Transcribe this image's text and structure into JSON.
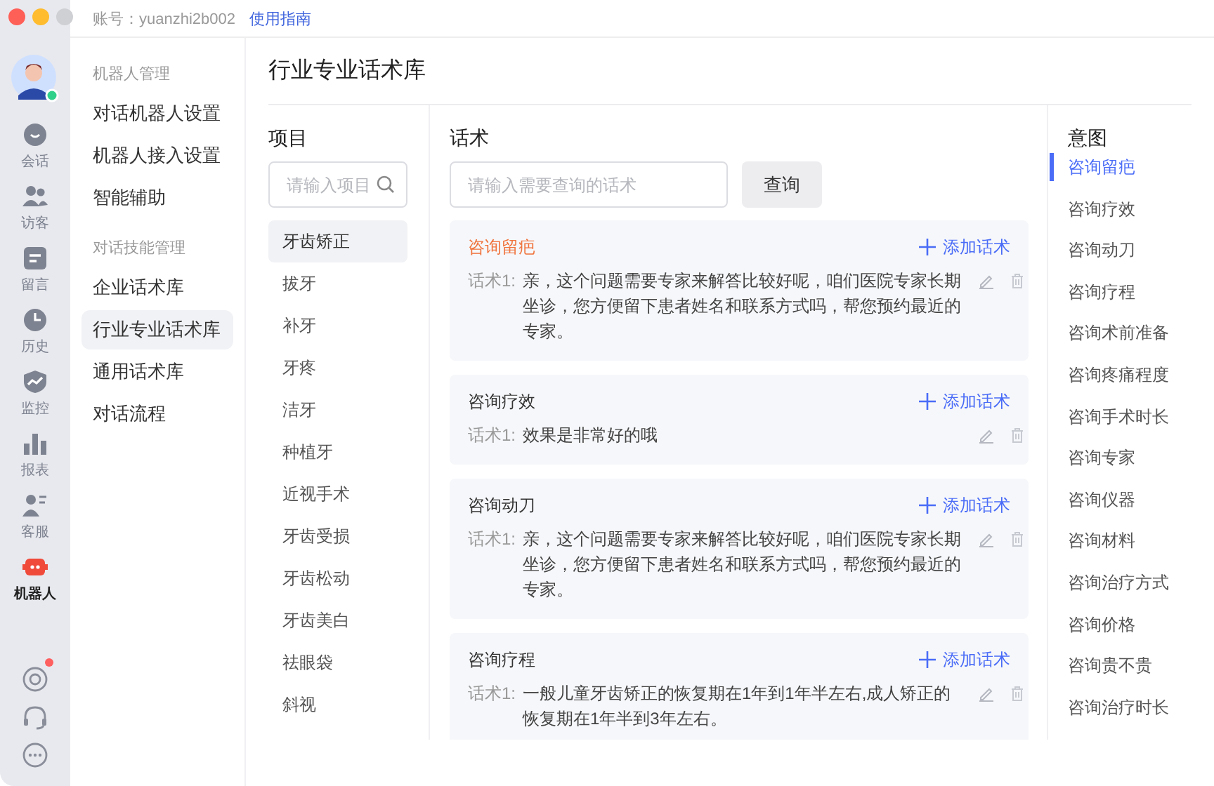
{
  "account": {
    "label": "账号：yuanzhi2b002",
    "link": "使用指南"
  },
  "rail": {
    "items": [
      {
        "label": "会话",
        "kind": "chat",
        "selected": false
      },
      {
        "label": "访客",
        "kind": "visitors",
        "selected": false
      },
      {
        "label": "留言",
        "kind": "message",
        "selected": false
      },
      {
        "label": "历史",
        "kind": "history",
        "selected": false
      },
      {
        "label": "监控",
        "kind": "monitor",
        "selected": false
      },
      {
        "label": "报表",
        "kind": "report",
        "selected": false
      },
      {
        "label": "客服",
        "kind": "agent",
        "selected": false
      },
      {
        "label": "机器人",
        "kind": "robot",
        "selected": true
      }
    ],
    "bottom": [
      {
        "kind": "target",
        "badge": true
      },
      {
        "kind": "headset",
        "badge": false
      },
      {
        "kind": "more",
        "badge": false
      }
    ]
  },
  "nav": [
    {
      "heading": "机器人管理",
      "items": [
        {
          "label": "对话机器人设置",
          "selected": false
        },
        {
          "label": "机器人接入设置",
          "selected": false
        },
        {
          "label": "智能辅助",
          "selected": false
        }
      ]
    },
    {
      "heading": "对话技能管理",
      "items": [
        {
          "label": "企业话术库",
          "selected": false
        },
        {
          "label": "行业专业话术库",
          "selected": true
        },
        {
          "label": "通用话术库",
          "selected": false
        },
        {
          "label": "对话流程",
          "selected": false
        }
      ]
    }
  ],
  "page_title": "行业专业话术库",
  "projects": {
    "heading": "项目",
    "search": {
      "placeholder": "请输入项目"
    },
    "items": [
      {
        "label": "牙齿矫正",
        "selected": true
      },
      {
        "label": "拔牙",
        "selected": false
      },
      {
        "label": "补牙",
        "selected": false
      },
      {
        "label": "牙疼",
        "selected": false
      },
      {
        "label": "洁牙",
        "selected": false
      },
      {
        "label": "种植牙",
        "selected": false
      },
      {
        "label": "近视手术",
        "selected": false
      },
      {
        "label": "牙齿受损",
        "selected": false
      },
      {
        "label": "牙齿松动",
        "selected": false
      },
      {
        "label": "牙齿美白",
        "selected": false
      },
      {
        "label": "祛眼袋",
        "selected": false
      },
      {
        "label": "斜视",
        "selected": false
      }
    ]
  },
  "scripts": {
    "heading": "话术",
    "search": {
      "placeholder": "请输入需要查询的话术"
    },
    "button": "查询",
    "cards": [
      {
        "title": "咨询留疤",
        "selected": true,
        "add": "添加话术",
        "lines": [
          {
            "label": "话术1:",
            "text": "亲，这个问题需要专家来解答比较好呢，咱们医院专家长期坐诊，您方便留下患者姓名和联系方式吗，帮您预约最近的专家。"
          }
        ]
      },
      {
        "title": "咨询疗效",
        "selected": false,
        "add": "添加话术",
        "lines": [
          {
            "label": "话术1:",
            "text": "效果是非常好的哦"
          }
        ]
      },
      {
        "title": "咨询动刀",
        "selected": false,
        "add": "添加话术",
        "lines": [
          {
            "label": "话术1:",
            "text": "亲，这个问题需要专家来解答比较好呢，咱们医院专家长期坐诊，您方便留下患者姓名和联系方式吗，帮您预约最近的专家。"
          }
        ]
      },
      {
        "title": "咨询疗程",
        "selected": false,
        "add": "添加话术",
        "lines": [
          {
            "label": "话术1:",
            "text": "一般儿童牙齿矫正的恢复期在1年到1年半左右,成人矫正的恢复期在1年半到3年左右。"
          }
        ]
      }
    ]
  },
  "intents": {
    "heading": "意图",
    "items": [
      {
        "label": "咨询留疤",
        "selected": true
      },
      {
        "label": "咨询疗效",
        "selected": false
      },
      {
        "label": "咨询动刀",
        "selected": false
      },
      {
        "label": "咨询疗程",
        "selected": false
      },
      {
        "label": "咨询术前准备",
        "selected": false
      },
      {
        "label": "咨询疼痛程度",
        "selected": false
      },
      {
        "label": "咨询手术时长",
        "selected": false
      },
      {
        "label": "咨询专家",
        "selected": false
      },
      {
        "label": "咨询仪器",
        "selected": false
      },
      {
        "label": "咨询材料",
        "selected": false
      },
      {
        "label": "咨询治疗方式",
        "selected": false
      },
      {
        "label": "咨询价格",
        "selected": false
      },
      {
        "label": "咨询贵不贵",
        "selected": false
      },
      {
        "label": "咨询治疗时长",
        "selected": false
      }
    ]
  }
}
